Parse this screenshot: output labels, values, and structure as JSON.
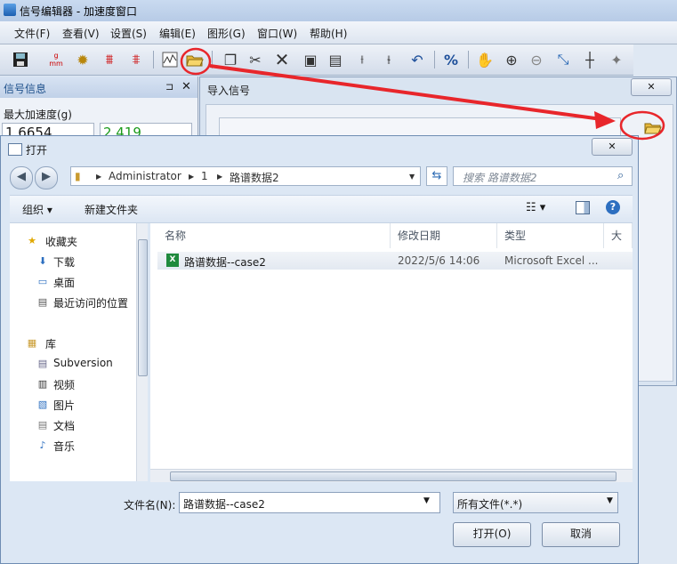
{
  "app": {
    "title": "信号编辑器 - 加速度窗口"
  },
  "menu": [
    "文件(F)",
    "查看(V)",
    "设置(S)",
    "编辑(E)",
    "图形(G)",
    "窗口(W)",
    "帮助(H)"
  ],
  "toolbar": {
    "unit_top": "g",
    "unit_bottom": "mm",
    "percent": "%"
  },
  "left_panel": {
    "title": "信号信息",
    "max_accel_label": "最大加速度(g)",
    "value_1": "1.6654",
    "value_2": "2.419"
  },
  "import_dialog": {
    "title": "导入信号"
  },
  "open_dialog": {
    "title": "打开",
    "breadcrumb": [
      "Administrator",
      "1",
      "路谱数据2"
    ],
    "search_placeholder": "搜索 路谱数据2",
    "organize": "组织",
    "new_folder": "新建文件夹",
    "help": "?",
    "nav": {
      "favorites": "收藏夹",
      "favorites_items": [
        "下载",
        "桌面",
        "最近访问的位置"
      ],
      "library": "库",
      "library_items": [
        "Subversion",
        "视频",
        "图片",
        "文档",
        "音乐"
      ]
    },
    "columns": [
      "名称",
      "修改日期",
      "类型",
      "大小"
    ],
    "files": [
      {
        "name": "路谱数据--case2",
        "date": "2022/5/6 14:06",
        "type": "Microsoft Excel ..."
      }
    ],
    "filename_label": "文件名(N):",
    "filename_value": "路谱数据--case2",
    "filetype_value": "所有文件(*.*)",
    "open_button": "打开(O)",
    "cancel_button": "取消"
  },
  "colors": {
    "annotation": "#e8262b",
    "value_green": "#1a9a1a"
  }
}
